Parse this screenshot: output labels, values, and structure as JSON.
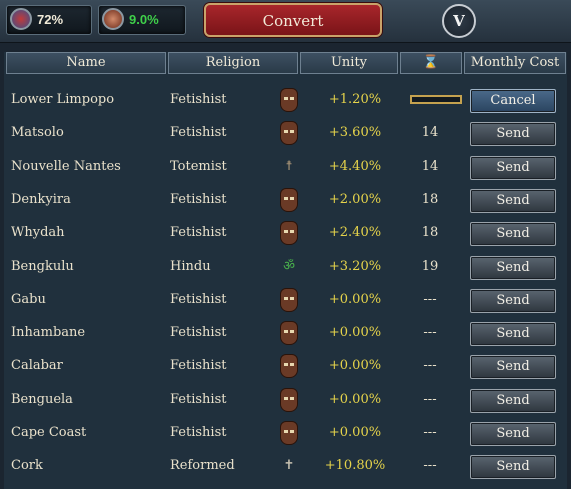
{
  "top": {
    "stat1_value": "72%",
    "stat2_value": "9.0%",
    "title": "Convert",
    "badge": "V",
    "stat1_color": "#f0ead8",
    "stat2_color": "#3fcf4a"
  },
  "table": {
    "headers": {
      "name": "Name",
      "religion": "Religion",
      "unity": "Unity",
      "time_icon": "hourglass-icon",
      "monthly_cost": "Monthly Cost"
    },
    "rows": [
      {
        "name": "Lower Limpopo",
        "religion": "Fetishist",
        "icon": "fetishist-mask-icon",
        "unity": "+1.20%",
        "time": "",
        "action": "Cancel",
        "progress": 0
      },
      {
        "name": "Matsolo",
        "religion": "Fetishist",
        "icon": "fetishist-mask-icon",
        "unity": "+3.60%",
        "time": "14",
        "action": "Send"
      },
      {
        "name": "Nouvelle Nantes",
        "religion": "Totemist",
        "icon": "totem-icon",
        "unity": "+4.40%",
        "time": "14",
        "action": "Send"
      },
      {
        "name": "Denkyira",
        "religion": "Fetishist",
        "icon": "fetishist-mask-icon",
        "unity": "+2.00%",
        "time": "18",
        "action": "Send"
      },
      {
        "name": "Whydah",
        "religion": "Fetishist",
        "icon": "fetishist-mask-icon",
        "unity": "+2.40%",
        "time": "18",
        "action": "Send"
      },
      {
        "name": "Bengkulu",
        "religion": "Hindu",
        "icon": "om-icon",
        "unity": "+3.20%",
        "time": "19",
        "action": "Send"
      },
      {
        "name": "Gabu",
        "religion": "Fetishist",
        "icon": "fetishist-mask-icon",
        "unity": "+0.00%",
        "time": "---",
        "action": "Send"
      },
      {
        "name": "Inhambane",
        "religion": "Fetishist",
        "icon": "fetishist-mask-icon",
        "unity": "+0.00%",
        "time": "---",
        "action": "Send"
      },
      {
        "name": "Calabar",
        "religion": "Fetishist",
        "icon": "fetishist-mask-icon",
        "unity": "+0.00%",
        "time": "---",
        "action": "Send"
      },
      {
        "name": "Benguela",
        "religion": "Fetishist",
        "icon": "fetishist-mask-icon",
        "unity": "+0.00%",
        "time": "---",
        "action": "Send"
      },
      {
        "name": "Cape Coast",
        "religion": "Fetishist",
        "icon": "fetishist-mask-icon",
        "unity": "+0.00%",
        "time": "---",
        "action": "Send"
      },
      {
        "name": "Cork",
        "religion": "Reformed",
        "icon": "cross-icon",
        "unity": "+10.80%",
        "time": "---",
        "action": "Send"
      }
    ]
  }
}
